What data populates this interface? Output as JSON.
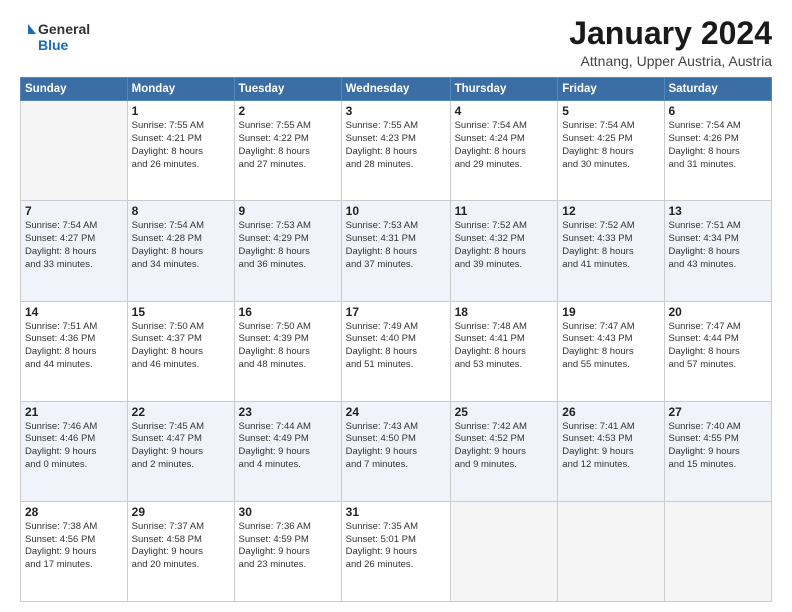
{
  "header": {
    "logo_general": "General",
    "logo_blue": "Blue",
    "title": "January 2024",
    "subtitle": "Attnang, Upper Austria, Austria"
  },
  "days_header": [
    "Sunday",
    "Monday",
    "Tuesday",
    "Wednesday",
    "Thursday",
    "Friday",
    "Saturday"
  ],
  "weeks": [
    [
      {
        "day": "",
        "info": ""
      },
      {
        "day": "1",
        "info": "Sunrise: 7:55 AM\nSunset: 4:21 PM\nDaylight: 8 hours\nand 26 minutes."
      },
      {
        "day": "2",
        "info": "Sunrise: 7:55 AM\nSunset: 4:22 PM\nDaylight: 8 hours\nand 27 minutes."
      },
      {
        "day": "3",
        "info": "Sunrise: 7:55 AM\nSunset: 4:23 PM\nDaylight: 8 hours\nand 28 minutes."
      },
      {
        "day": "4",
        "info": "Sunrise: 7:54 AM\nSunset: 4:24 PM\nDaylight: 8 hours\nand 29 minutes."
      },
      {
        "day": "5",
        "info": "Sunrise: 7:54 AM\nSunset: 4:25 PM\nDaylight: 8 hours\nand 30 minutes."
      },
      {
        "day": "6",
        "info": "Sunrise: 7:54 AM\nSunset: 4:26 PM\nDaylight: 8 hours\nand 31 minutes."
      }
    ],
    [
      {
        "day": "7",
        "info": "Sunrise: 7:54 AM\nSunset: 4:27 PM\nDaylight: 8 hours\nand 33 minutes."
      },
      {
        "day": "8",
        "info": "Sunrise: 7:54 AM\nSunset: 4:28 PM\nDaylight: 8 hours\nand 34 minutes."
      },
      {
        "day": "9",
        "info": "Sunrise: 7:53 AM\nSunset: 4:29 PM\nDaylight: 8 hours\nand 36 minutes."
      },
      {
        "day": "10",
        "info": "Sunrise: 7:53 AM\nSunset: 4:31 PM\nDaylight: 8 hours\nand 37 minutes."
      },
      {
        "day": "11",
        "info": "Sunrise: 7:52 AM\nSunset: 4:32 PM\nDaylight: 8 hours\nand 39 minutes."
      },
      {
        "day": "12",
        "info": "Sunrise: 7:52 AM\nSunset: 4:33 PM\nDaylight: 8 hours\nand 41 minutes."
      },
      {
        "day": "13",
        "info": "Sunrise: 7:51 AM\nSunset: 4:34 PM\nDaylight: 8 hours\nand 43 minutes."
      }
    ],
    [
      {
        "day": "14",
        "info": "Sunrise: 7:51 AM\nSunset: 4:36 PM\nDaylight: 8 hours\nand 44 minutes."
      },
      {
        "day": "15",
        "info": "Sunrise: 7:50 AM\nSunset: 4:37 PM\nDaylight: 8 hours\nand 46 minutes."
      },
      {
        "day": "16",
        "info": "Sunrise: 7:50 AM\nSunset: 4:39 PM\nDaylight: 8 hours\nand 48 minutes."
      },
      {
        "day": "17",
        "info": "Sunrise: 7:49 AM\nSunset: 4:40 PM\nDaylight: 8 hours\nand 51 minutes."
      },
      {
        "day": "18",
        "info": "Sunrise: 7:48 AM\nSunset: 4:41 PM\nDaylight: 8 hours\nand 53 minutes."
      },
      {
        "day": "19",
        "info": "Sunrise: 7:47 AM\nSunset: 4:43 PM\nDaylight: 8 hours\nand 55 minutes."
      },
      {
        "day": "20",
        "info": "Sunrise: 7:47 AM\nSunset: 4:44 PM\nDaylight: 8 hours\nand 57 minutes."
      }
    ],
    [
      {
        "day": "21",
        "info": "Sunrise: 7:46 AM\nSunset: 4:46 PM\nDaylight: 9 hours\nand 0 minutes."
      },
      {
        "day": "22",
        "info": "Sunrise: 7:45 AM\nSunset: 4:47 PM\nDaylight: 9 hours\nand 2 minutes."
      },
      {
        "day": "23",
        "info": "Sunrise: 7:44 AM\nSunset: 4:49 PM\nDaylight: 9 hours\nand 4 minutes."
      },
      {
        "day": "24",
        "info": "Sunrise: 7:43 AM\nSunset: 4:50 PM\nDaylight: 9 hours\nand 7 minutes."
      },
      {
        "day": "25",
        "info": "Sunrise: 7:42 AM\nSunset: 4:52 PM\nDaylight: 9 hours\nand 9 minutes."
      },
      {
        "day": "26",
        "info": "Sunrise: 7:41 AM\nSunset: 4:53 PM\nDaylight: 9 hours\nand 12 minutes."
      },
      {
        "day": "27",
        "info": "Sunrise: 7:40 AM\nSunset: 4:55 PM\nDaylight: 9 hours\nand 15 minutes."
      }
    ],
    [
      {
        "day": "28",
        "info": "Sunrise: 7:38 AM\nSunset: 4:56 PM\nDaylight: 9 hours\nand 17 minutes."
      },
      {
        "day": "29",
        "info": "Sunrise: 7:37 AM\nSunset: 4:58 PM\nDaylight: 9 hours\nand 20 minutes."
      },
      {
        "day": "30",
        "info": "Sunrise: 7:36 AM\nSunset: 4:59 PM\nDaylight: 9 hours\nand 23 minutes."
      },
      {
        "day": "31",
        "info": "Sunrise: 7:35 AM\nSunset: 5:01 PM\nDaylight: 9 hours\nand 26 minutes."
      },
      {
        "day": "",
        "info": ""
      },
      {
        "day": "",
        "info": ""
      },
      {
        "day": "",
        "info": ""
      }
    ]
  ]
}
